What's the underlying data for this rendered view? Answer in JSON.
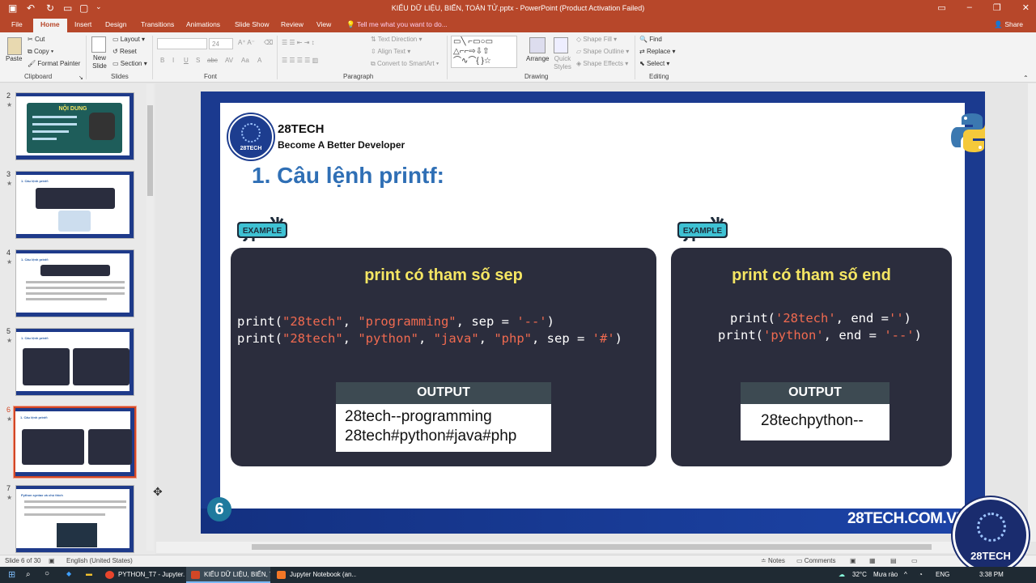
{
  "window": {
    "title": "KIỂU DỮ LIỆU, BIẾN, TOÁN TỬ.pptx  -  PowerPoint (Product Activation Failed)"
  },
  "tabs": [
    "File",
    "Home",
    "Insert",
    "Design",
    "Transitions",
    "Animations",
    "Slide Show",
    "Review",
    "View"
  ],
  "tell_me": "Tell me what you want to do...",
  "share": "Share",
  "ribbon": {
    "clipboard": {
      "paste": "Paste",
      "cut": "Cut",
      "copy": "Copy",
      "format_painter": "Format Painter",
      "label": "Clipboard"
    },
    "slides": {
      "new_slide": "New Slide",
      "layout": "Layout",
      "reset": "Reset",
      "section": "Section",
      "label": "Slides"
    },
    "font": {
      "size": "24",
      "label": "Font",
      "buttons": [
        "B",
        "I",
        "U",
        "S",
        "abc",
        "AV",
        "Aa",
        "A"
      ]
    },
    "paragraph": {
      "text_direction": "Text Direction",
      "align_text": "Align Text",
      "smartart": "Convert to SmartArt",
      "label": "Paragraph"
    },
    "drawing": {
      "arrange": "Arrange",
      "quick_styles": "Quick Styles",
      "shape_fill": "Shape Fill",
      "shape_outline": "Shape Outline",
      "shape_effects": "Shape Effects",
      "label": "Drawing"
    },
    "editing": {
      "find": "Find",
      "replace": "Replace",
      "select": "Select",
      "label": "Editing"
    }
  },
  "thumbnails": [
    {
      "num": "2",
      "title": "NỘI DUNG"
    },
    {
      "num": "3",
      "title": "1. Câu lệnh printf:"
    },
    {
      "num": "4",
      "title": "1. Câu lệnh printf:"
    },
    {
      "num": "5",
      "title": "1. Câu lệnh printf:"
    },
    {
      "num": "6",
      "title": "1. Câu lệnh printf:"
    },
    {
      "num": "7",
      "title": "Python syntax và chú thích"
    }
  ],
  "slide": {
    "brand": "28TECH",
    "tagline": "Become A Better Developer",
    "logo_text": "28TECH",
    "heading": "1. Câu lệnh printf:",
    "example_label": "EXAMPLE",
    "left_card": {
      "title": "print có tham số sep",
      "line1": {
        "a": "print(",
        "s1": "\"28tech\"",
        "b": ", ",
        "s2": "\"programming\"",
        "c": ", sep = ",
        "s3": "'--'",
        "d": ")"
      },
      "line2": {
        "a": "print(",
        "s1": "\"28tech\"",
        "b": ", ",
        "s2": "\"python\"",
        "c": ", ",
        "s3": "\"java\"",
        "d": ", ",
        "s4": "\"php\"",
        "e": ", sep = ",
        "s5": "'#'",
        "f": ")"
      },
      "output_label": "OUTPUT",
      "output_lines": [
        "28tech--programming",
        "28tech#python#java#php"
      ]
    },
    "right_card": {
      "title": "print có tham số end",
      "line1": {
        "a": "print(",
        "s1": "'28tech'",
        "b": ", end =",
        "s2": "''",
        "c": ")"
      },
      "line2": {
        "a": "print(",
        "s1": "'python'",
        "b": ", end = ",
        "s2": "'--'",
        "c": ")"
      },
      "output_label": "OUTPUT",
      "output_lines": [
        "28techpython--"
      ]
    },
    "slide_number": "6",
    "url": "28TECH.COM.VN"
  },
  "corner_logo_text": "28TECH",
  "statusbar": {
    "slide_info": "Slide 6 of 30",
    "language": "English (United States)",
    "notes": "Notes",
    "comments": "Comments"
  },
  "taskbar": {
    "items": [
      "PYTHON_T7 - Jupyter...",
      "KIỂU DỮ LIỆU, BIẾN, T...",
      "Jupyter Notebook (an..."
    ],
    "temp": "32°C",
    "weather": "Mưa rào",
    "lang": "ENG",
    "time": "3:38 PM"
  },
  "colors": {
    "accent": "#b7472a",
    "slide_frame": "#1b3a8f",
    "heading": "#2f6fb5",
    "card": "#2b2d3d",
    "card_title": "#f5e663",
    "code_string": "#f06a50"
  }
}
